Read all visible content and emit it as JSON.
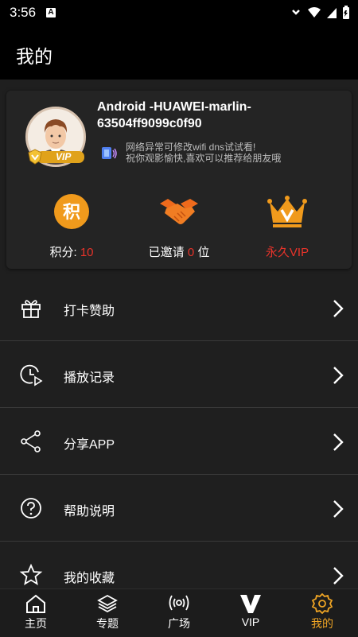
{
  "status_bar": {
    "time": "3:56",
    "notification_letter": "A"
  },
  "header": {
    "title": "我的"
  },
  "profile": {
    "username": "Android -HUAWEI-marlin-63504ff9099c0f90",
    "vip_badge": "VIP",
    "notice_lines": [
      "网络异常可修改wifi dns试试看!",
      "祝你观影愉快,喜欢可以推荐给朋友哦"
    ]
  },
  "stats": {
    "points": {
      "icon_text": "积",
      "label": "积分:",
      "value": "10"
    },
    "invites": {
      "label_prefix": "已邀请",
      "value": "0",
      "label_suffix": "位"
    },
    "vip": {
      "label": "永久VIP"
    }
  },
  "menu": [
    {
      "label": "打卡赞助",
      "icon": "gift-icon"
    },
    {
      "label": "播放记录",
      "icon": "history-icon"
    },
    {
      "label": "分享APP",
      "icon": "share-icon"
    },
    {
      "label": "帮助说明",
      "icon": "help-icon"
    },
    {
      "label": "我的收藏",
      "icon": "star-icon"
    }
  ],
  "tabs": [
    {
      "label": "主页",
      "icon": "home-icon"
    },
    {
      "label": "专题",
      "icon": "layers-icon"
    },
    {
      "label": "广场",
      "icon": "broadcast-icon"
    },
    {
      "label": "VIP",
      "icon": "vip-v-icon"
    },
    {
      "label": "我的",
      "icon": "gear-icon",
      "active": true
    }
  ],
  "colors": {
    "accent": "#f0a524",
    "highlight_red": "#e8332a",
    "background": "#1f1f1f"
  }
}
